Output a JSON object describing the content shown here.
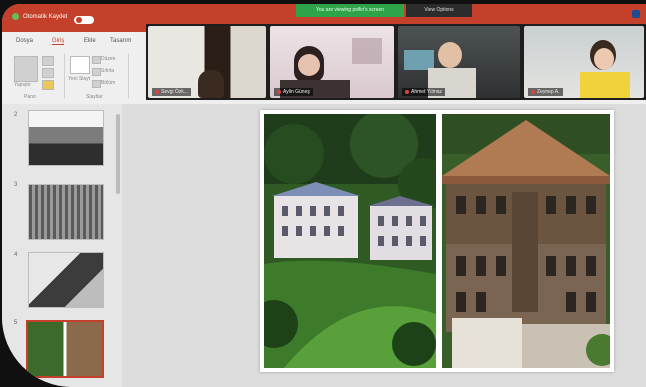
{
  "app": {
    "autosave_label": "Otomatik Kaydet",
    "sharing_banner": "You are viewing pellin's screen",
    "view_options_label": "View Options"
  },
  "ribbon": {
    "tabs": [
      "Dosya",
      "Giriş",
      "Ekle",
      "Tasarım"
    ],
    "clipboard": {
      "paste_label": "Yapıştır",
      "group_label": "Pano"
    },
    "slides": {
      "new_slide_label": "Yeni Slayt",
      "layout_label": "Düzen",
      "reset_label": "Sıfırla",
      "section_label": "Bölüm",
      "group_label": "Slaytlar"
    }
  },
  "videos": [
    {
      "name": "Sevgi Özk..."
    },
    {
      "name": "Aylin Güneş"
    },
    {
      "name": "Ahmet Yılmaz"
    },
    {
      "name": "Zeynep A."
    }
  ],
  "thumbnails": {
    "numbers": [
      "2",
      "3",
      "4",
      "5"
    ]
  },
  "colors": {
    "accent": "#c4402a",
    "share_green": "#2ea34a"
  }
}
